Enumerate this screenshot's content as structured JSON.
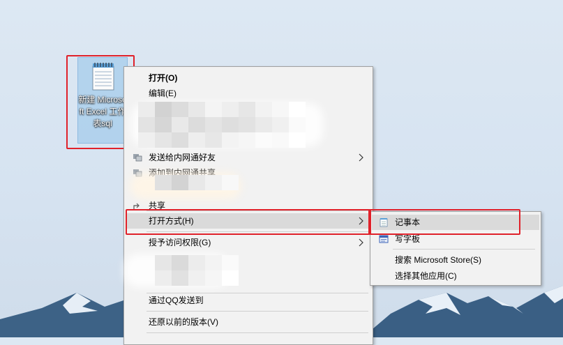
{
  "desktop_icon": {
    "name": "新建 Microsoft Excel 工作表sql",
    "icon": "notepad-document-icon"
  },
  "context_menu": {
    "items": [
      {
        "label": "打开(O)",
        "bold": true
      },
      {
        "label": "编辑(E)"
      },
      {
        "label": "发送给内网通好友",
        "icon": "network-share-icon",
        "has_submenu": true
      },
      {
        "label": "添加到内网通共享",
        "icon": "network-share-icon"
      },
      {
        "label": "共享",
        "icon": "share-icon"
      },
      {
        "label": "打开方式(H)",
        "has_submenu": true,
        "highlighted": true
      },
      {
        "label": "授予访问权限(G)",
        "has_submenu": true
      },
      {
        "label": "通过QQ发送到"
      },
      {
        "label": "还原以前的版本(V)"
      }
    ]
  },
  "open_with_submenu": {
    "items": [
      {
        "label": "记事本",
        "icon": "notepad-icon",
        "highlighted": true
      },
      {
        "label": "写字板",
        "icon": "wordpad-icon"
      },
      {
        "label": "搜索 Microsoft Store(S)"
      },
      {
        "label": "选择其他应用(C)"
      }
    ]
  },
  "colors": {
    "highlight_border": "#e0212a",
    "menu_bg": "#f2f2f2",
    "menu_hover": "#dadada"
  }
}
